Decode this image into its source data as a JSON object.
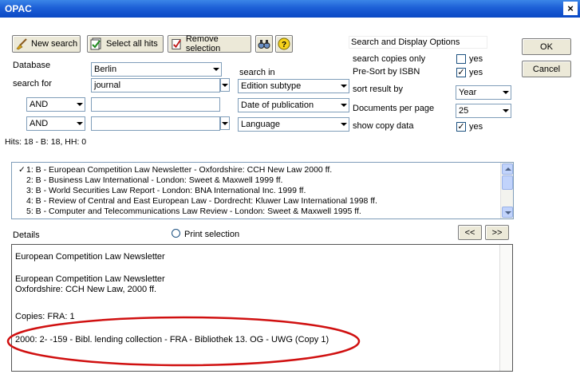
{
  "window": {
    "title": "OPAC",
    "close_glyph": "×"
  },
  "toolbar": {
    "new_search": "New search",
    "select_all": "Select all hits",
    "remove_selection": "Remove selection",
    "icons": [
      "broom-icon",
      "select-all-icon",
      "remove-selection-icon",
      "binoculars-icon",
      "help-icon"
    ]
  },
  "options_panel": {
    "title": "Search and Display Options",
    "search_copies_only": "search copies only",
    "search_copies_value": "yes",
    "pre_sort": "Pre-Sort by ISBN",
    "pre_sort_value": "yes",
    "sort_result_by": "sort result by",
    "sort_value": "Year",
    "documents_per_page": "Documents per page",
    "documents_value": "25",
    "show_copy_data": "show copy data",
    "show_copy_value": "yes"
  },
  "dialog_buttons": {
    "ok": "OK",
    "cancel": "Cancel"
  },
  "search": {
    "database_label": "Database",
    "database_value": "Berlin",
    "search_in_label": "search in",
    "search_for_label": "search for",
    "term1": "journal",
    "field1": "Edition subtype",
    "op2": "AND",
    "term2": "",
    "field2": "Date of publication",
    "op3": "AND",
    "term3": "",
    "field3": "Language"
  },
  "hits_text": "Hits: 18 - B: 18, HH: 0",
  "results": [
    {
      "mark": "✓",
      "text": "1: B - European Competition Law Newsletter - Oxfordshire: CCH New Law 2000 ff."
    },
    {
      "mark": "",
      "text": "2: B - Business Law International - London: Sweet & Maxwell 1999 ff."
    },
    {
      "mark": "",
      "text": "3: B - World Securities Law Report - London: BNA International Inc. 1999 ff."
    },
    {
      "mark": "",
      "text": "4: B - Review of Central and East European Law - Dordrecht: Kluwer Law International 1998 ff."
    },
    {
      "mark": "",
      "text": "5: B - Computer and Telecommunications Law Review - London: Sweet & Maxwell 1995 ff."
    }
  ],
  "details": {
    "label": "Details",
    "print_selection": "Print selection",
    "prev": "<<",
    "next": ">>",
    "lines": [
      "European Competition Law Newsletter",
      "European Competition Law Newsletter",
      "Oxfordshire: CCH New Law, 2000 ff.",
      "Copies:  FRA: 1",
      "2000: 2- -159 - Bibl. lending collection - FRA - Bibliothek 13. OG - UWG (Copy 1)"
    ]
  },
  "colors": {
    "title_bar": "#1d5fd6",
    "annotation": "#d01010",
    "dialog_bg": "#ffffff"
  }
}
